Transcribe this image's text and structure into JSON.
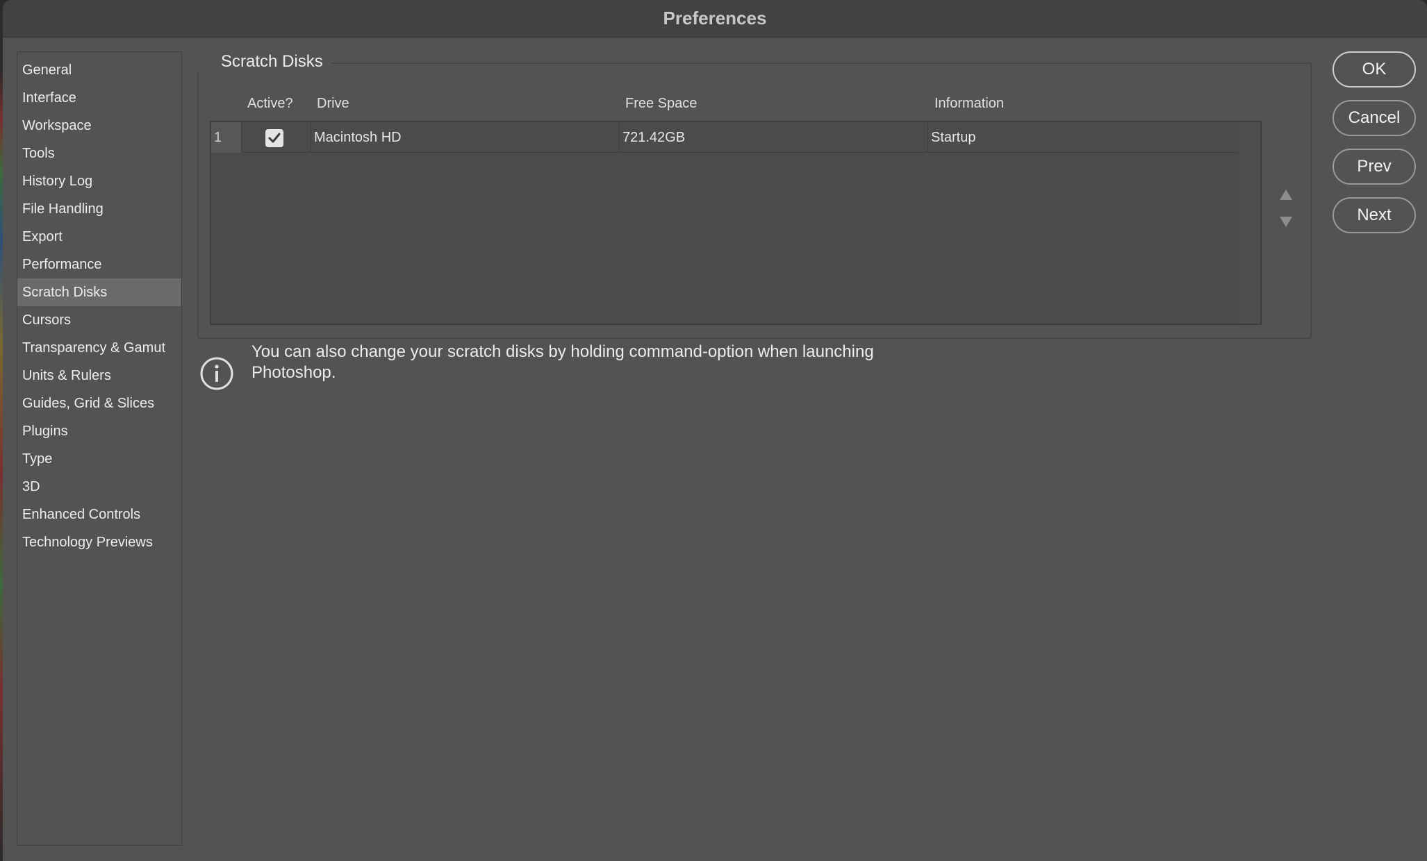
{
  "window": {
    "title": "Preferences"
  },
  "sidebar": {
    "items": [
      {
        "label": "General"
      },
      {
        "label": "Interface"
      },
      {
        "label": "Workspace"
      },
      {
        "label": "Tools"
      },
      {
        "label": "History Log"
      },
      {
        "label": "File Handling"
      },
      {
        "label": "Export"
      },
      {
        "label": "Performance"
      },
      {
        "label": "Scratch Disks"
      },
      {
        "label": "Cursors"
      },
      {
        "label": "Transparency & Gamut"
      },
      {
        "label": "Units & Rulers"
      },
      {
        "label": "Guides, Grid & Slices"
      },
      {
        "label": "Plugins"
      },
      {
        "label": "Type"
      },
      {
        "label": "3D"
      },
      {
        "label": "Enhanced Controls"
      },
      {
        "label": "Technology Previews"
      }
    ],
    "selected": "Scratch Disks"
  },
  "scratch_disks": {
    "group_title": "Scratch Disks",
    "columns": {
      "active": "Active?",
      "drive": "Drive",
      "free_space": "Free Space",
      "information": "Information"
    },
    "rows": [
      {
        "index": "1",
        "active": true,
        "drive": "Macintosh HD",
        "free_space": "721.42GB",
        "information": "Startup"
      }
    ],
    "info_text": "You can also change your scratch disks by holding command-option when launching Photoshop."
  },
  "buttons": {
    "ok": "OK",
    "cancel": "Cancel",
    "prev": "Prev",
    "next": "Next"
  },
  "icons": {
    "move_up": "triangle-up-icon",
    "move_down": "triangle-down-icon",
    "info": "info-circle-icon",
    "check": "checkmark-icon"
  },
  "colors": {
    "window_bg": "#535353",
    "titlebar_bg": "#424242",
    "selected_item": "#6a6a6a"
  }
}
